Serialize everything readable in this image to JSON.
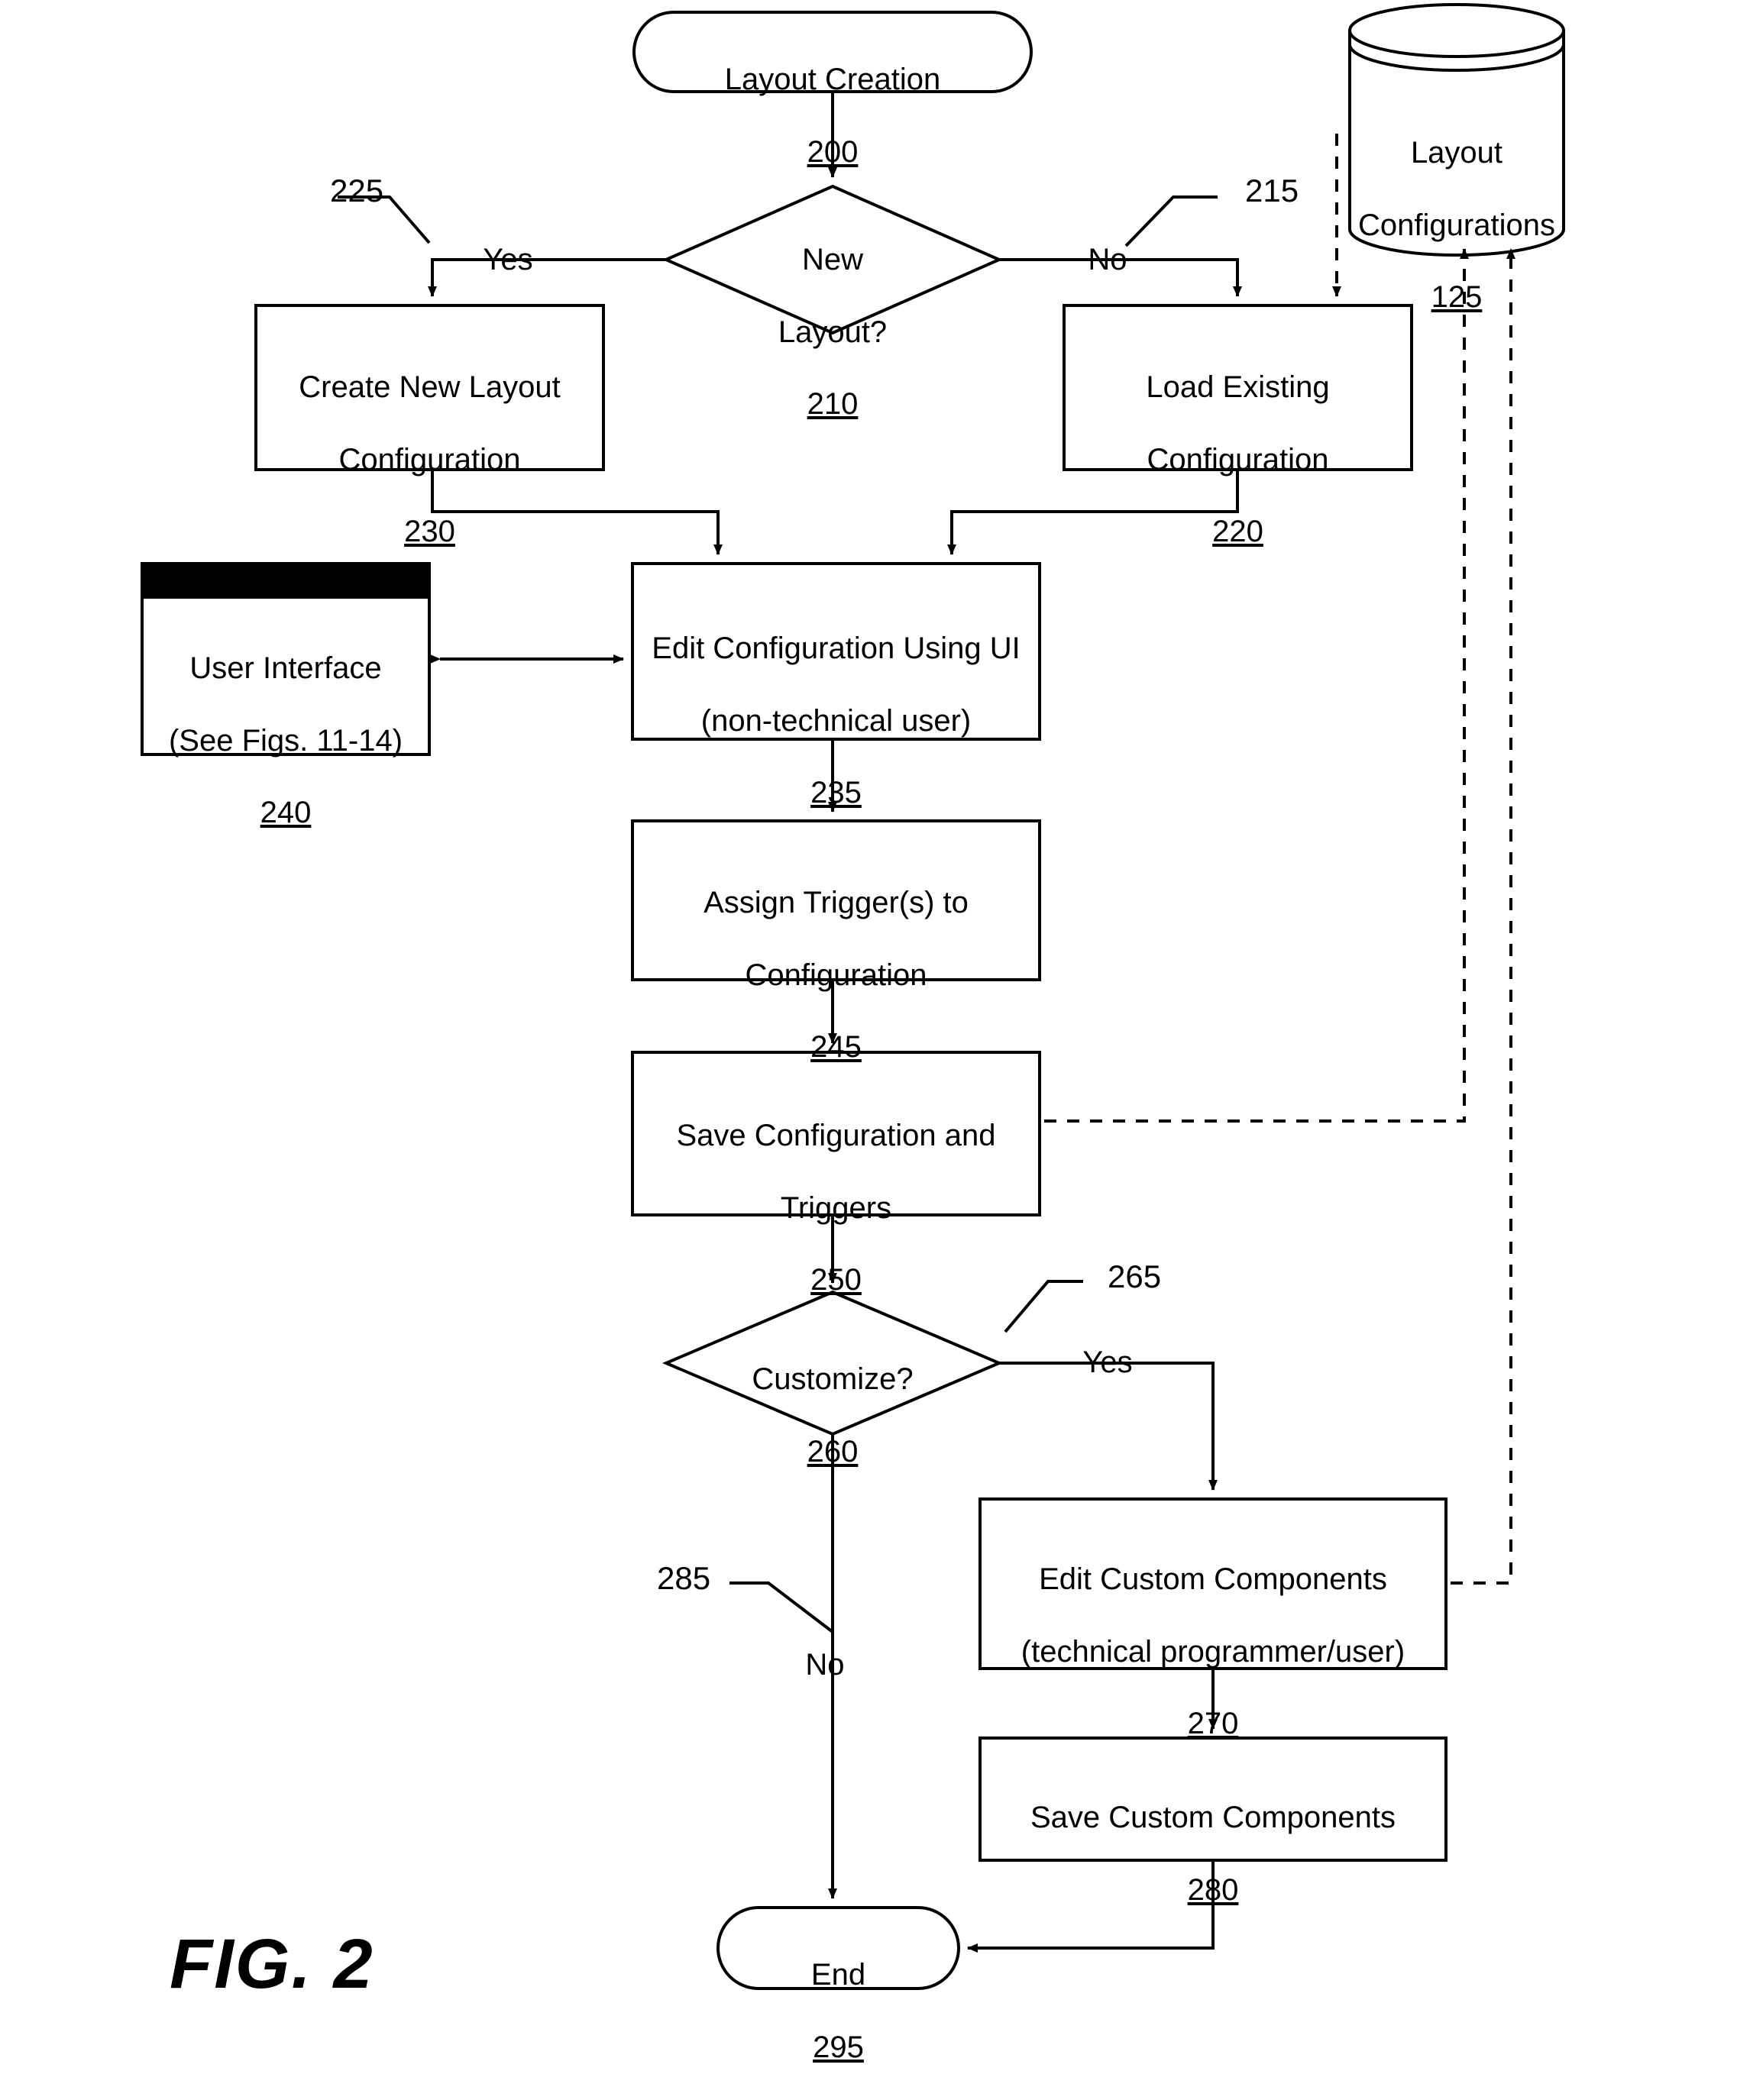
{
  "figure": {
    "label": "FIG. 2",
    "title": "Layout Creation flowchart"
  },
  "nodes": {
    "start": {
      "shape": "terminator",
      "label": "Layout Creation",
      "ref": "200"
    },
    "new_layout_decision": {
      "shape": "decision",
      "label_line1": "New",
      "label_line2": "Layout?",
      "ref": "210"
    },
    "create_new": {
      "shape": "process",
      "label_line1": "Create New Layout",
      "label_line2": "Configuration",
      "ref": "230"
    },
    "load_existing": {
      "shape": "process",
      "label_line1": "Load Existing",
      "label_line2": "Configuration",
      "ref": "220"
    },
    "datastore": {
      "shape": "database",
      "label_line1": "Layout",
      "label_line2": "Configurations",
      "ref": "125"
    },
    "user_interface": {
      "shape": "window",
      "label_line1": "User Interface",
      "label_line2": "(See Figs. 11-14)",
      "ref": "240"
    },
    "edit_config": {
      "shape": "process",
      "label_line1": "Edit Configuration Using UI",
      "label_line2": "(non-technical user)",
      "ref": "235"
    },
    "assign_triggers": {
      "shape": "process",
      "label_line1": "Assign Trigger(s) to",
      "label_line2": "Configuration",
      "ref": "245"
    },
    "save_config": {
      "shape": "process",
      "label_line1": "Save Configuration and",
      "label_line2": "Triggers",
      "ref": "250"
    },
    "customize_decision": {
      "shape": "decision",
      "label_line1": "Customize?",
      "ref": "260"
    },
    "edit_custom": {
      "shape": "process",
      "label_line1": "Edit Custom Components",
      "label_line2": "(technical programmer/user)",
      "ref": "270"
    },
    "save_custom": {
      "shape": "process",
      "label_line1": "Save Custom Components",
      "ref": "280"
    },
    "end": {
      "shape": "terminator",
      "label": "End",
      "ref": "295"
    }
  },
  "edge_labels": {
    "new_layout_yes": "Yes",
    "new_layout_no": "No",
    "customize_yes": "Yes",
    "customize_no": "No"
  },
  "callouts": {
    "yes_branch_225": "225",
    "no_branch_215": "215",
    "customize_yes_265": "265",
    "customize_no_285": "285"
  },
  "colors": {
    "stroke": "#000000",
    "fill": "#ffffff",
    "titlebar": "#000000"
  }
}
